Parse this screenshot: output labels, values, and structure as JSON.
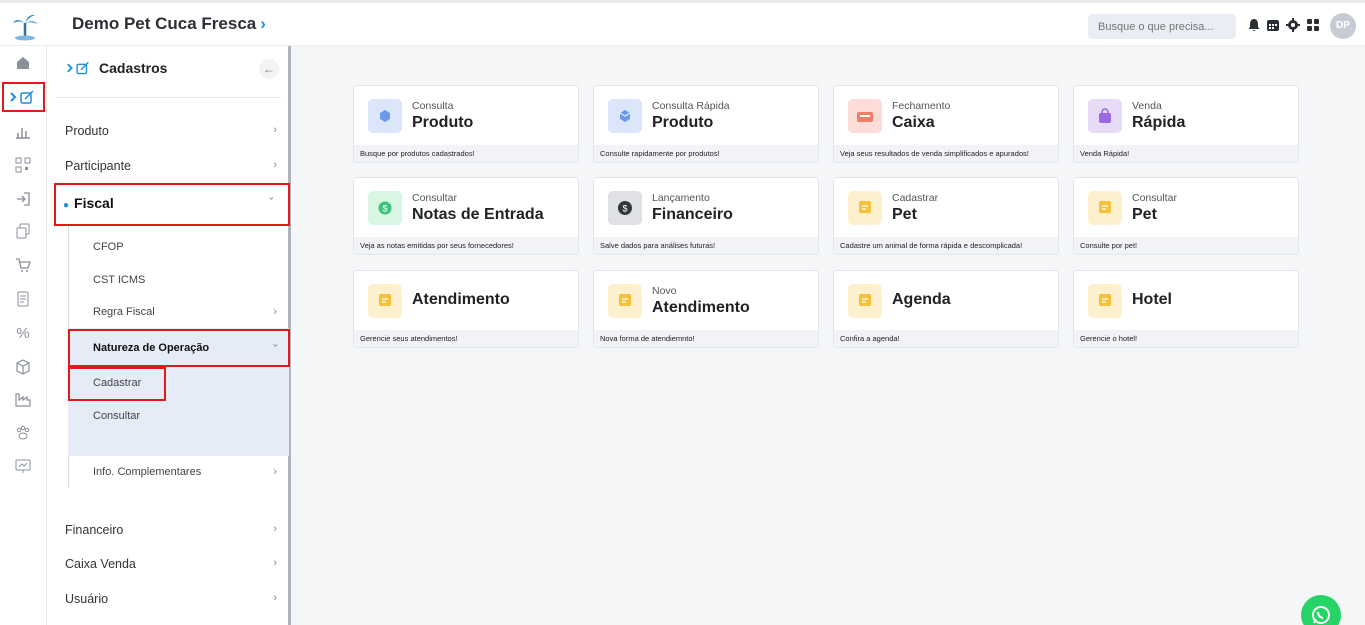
{
  "header": {
    "store_name": "Demo Pet Cuca Fresca",
    "search_placeholder": "Busque o que precisa...",
    "avatar_initials": "DP"
  },
  "menu": {
    "title": "Cadastros",
    "items": [
      {
        "label": "Produto"
      },
      {
        "label": "Participante"
      },
      {
        "label": "Fiscal"
      },
      {
        "label": "Financeiro"
      },
      {
        "label": "Caixa Venda"
      },
      {
        "label": "Usuário"
      }
    ],
    "fiscal_children": [
      {
        "label": "CFOP"
      },
      {
        "label": "CST ICMS"
      },
      {
        "label": "Regra Fiscal"
      },
      {
        "label": "Natureza de Operação"
      },
      {
        "label": "Info. Complementares"
      }
    ],
    "natureza_children": [
      {
        "label": "Cadastrar"
      },
      {
        "label": "Consultar"
      }
    ]
  },
  "cards": [
    {
      "small": "Consulta",
      "big": "Produto",
      "foot": "Busque por produtos cadastrados!",
      "icon": "cube-icon",
      "color": "#dbe6fb"
    },
    {
      "small": "Consulta Rápida",
      "big": "Produto",
      "foot": "Consulte rapidamente por produtos!",
      "icon": "box-icon",
      "color": "#dbe6fb"
    },
    {
      "small": "Fechamento",
      "big": "Caixa",
      "foot": "Veja seus resultados de venda simplificados e apurados!",
      "icon": "register-icon",
      "color": "#fbdcd6"
    },
    {
      "small": "Venda",
      "big": "Rápida",
      "foot": "Venda Rápida!",
      "icon": "bag-icon",
      "color": "#e6dcf8"
    },
    {
      "small": "Consultar",
      "big": "Notas de Entrada",
      "foot": "Veja as notas emitidas por seus fornecedores!",
      "icon": "money-icon",
      "color": "#d9f5e4"
    },
    {
      "small": "Lançamento",
      "big": "Financeiro",
      "foot": "Salve dados para análises futuras!",
      "icon": "finance-icon",
      "color": "#dfe1e5"
    },
    {
      "small": "Cadastrar",
      "big": "Pet",
      "foot": "Cadastre um animal de forma rápida e descomplicada!",
      "icon": "note-icon",
      "color": "#fdf0cc"
    },
    {
      "small": "Consultar",
      "big": "Pet",
      "foot": "Consulte por pet!",
      "icon": "note-icon",
      "color": "#fdf0cc"
    },
    {
      "small": "",
      "big": "Atendimento",
      "foot": "Gerencie seus atendimentos!",
      "icon": "note-icon",
      "color": "#fdf0cc"
    },
    {
      "small": "Novo",
      "big": "Atendimento",
      "foot": "Nova forma de atendiemnto!",
      "icon": "note-icon",
      "color": "#fdf0cc"
    },
    {
      "small": "",
      "big": "Agenda",
      "foot": "Confira a agenda!",
      "icon": "note-icon",
      "color": "#fdf0cc"
    },
    {
      "small": "",
      "big": "Hotel",
      "foot": "Gerencie o hotel!",
      "icon": "note-icon",
      "color": "#fdf0cc"
    }
  ]
}
